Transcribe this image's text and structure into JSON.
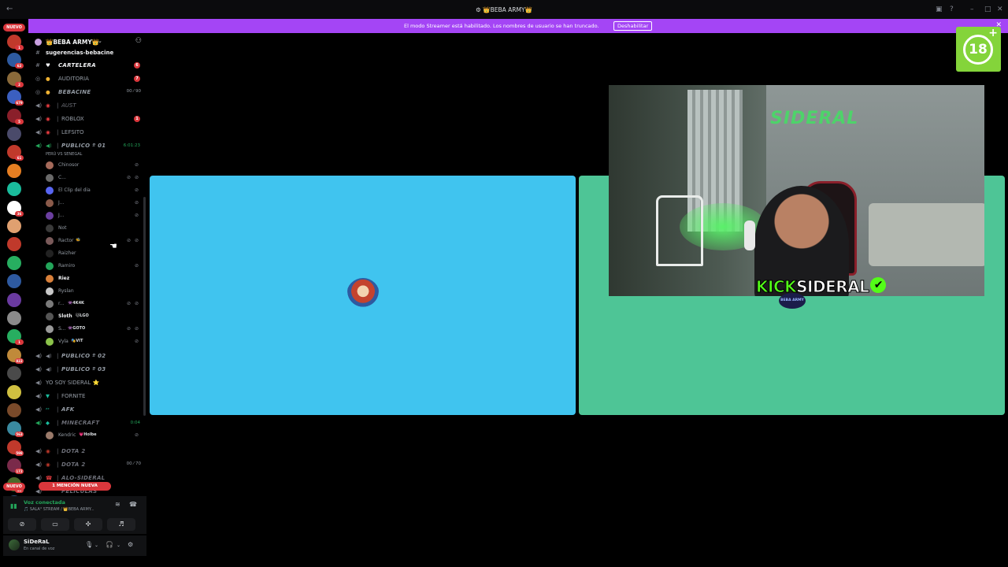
{
  "window": {
    "title": "👑BEBA ARMY👑"
  },
  "banner": {
    "message": "El modo Streamer está habilitado. Los nombres de usuario se han truncado.",
    "button": "Deshabilitar"
  },
  "rail": {
    "nuevo_top": "NUEVO",
    "nuevo_bottom": "NUEVO",
    "badges": [
      "1",
      "62",
      "2",
      "679",
      "5",
      "",
      "61",
      "",
      "",
      "36",
      "",
      "",
      "",
      "",
      "",
      "",
      "1",
      "822",
      "",
      "",
      "",
      "563",
      "598",
      "172",
      "44",
      "163",
      ""
    ]
  },
  "server": {
    "name": "👑BEBA ARMY👑"
  },
  "channels": {
    "top_partial": "sugerencias-bebacine",
    "cartelera": "CARTELERA",
    "cartelera_mentions": "6",
    "auditoria": "AUDITORIA",
    "auditoria_mentions": "7",
    "bebacine": "BEBACINE",
    "bebacine_limit": "00 ⁄ 90",
    "aust": "AUST",
    "roblox": "ROBLOX",
    "roblox_mentions": "1",
    "lefsito": "LEFSITO",
    "publico1": "PUBLICO º 01",
    "publico1_timer": "6:01:23",
    "publico1_status": "PERÚ VS SENEGAL",
    "publico2": "PUBLICO º 02",
    "publico3": "PUBLICO º 03",
    "yosoy": "YO SOY SIDERAL ⭐",
    "fornite": "FORNITE",
    "afk": "AFK",
    "minecraft": "MINECRAFT",
    "minecraft_timer": "0:04",
    "dota2a": "DOTA 2",
    "dota2b": "DOTA 2",
    "dota2b_limit": "00 ⁄ 70",
    "alo": "ALO-SIDERAL",
    "bottom_partial": "PELICULAS"
  },
  "voice_users": [
    {
      "name": "Chinosor",
      "tag": ""
    },
    {
      "name": "C...",
      "tag": ""
    },
    {
      "name": "El Clip del dia",
      "tag": ""
    },
    {
      "name": "J...",
      "tag": ""
    },
    {
      "name": "J...",
      "tag": ""
    },
    {
      "name": "Not",
      "tag": ""
    },
    {
      "name": "Ractor",
      "tag": "🐝"
    },
    {
      "name": "Raizher",
      "tag": ""
    },
    {
      "name": "Ramiro",
      "tag": ""
    },
    {
      "name": "Riez",
      "tag": ""
    },
    {
      "name": "Ryslan",
      "tag": ""
    },
    {
      "name": "r...",
      "tag": "👾4K4K"
    },
    {
      "name": "Sloth",
      "tag": "🐱LGO"
    },
    {
      "name": "S...",
      "tag": "👾GOTO"
    },
    {
      "name": "Vyla",
      "tag": "🎭VIT"
    }
  ],
  "minecraft_user": {
    "name": "Kendric",
    "tag": "💗Holbe"
  },
  "mention_pill": "1 MENCIÓN NUEVA",
  "voice_panel": {
    "status": "Voz conectada",
    "channel": "🎵 SALA° STREAM / 👑BEBA ARMY..."
  },
  "user_panel": {
    "name": "SiDeRaL",
    "status": "En canal de voz"
  },
  "stream": {
    "logo": "SIDERAL",
    "kick_label": "KICK",
    "kick_name": "SIDERAL",
    "check": "✔",
    "beba_logo": "BEBA ARMY"
  },
  "badge18": {
    "number": "18",
    "plus": "+"
  }
}
